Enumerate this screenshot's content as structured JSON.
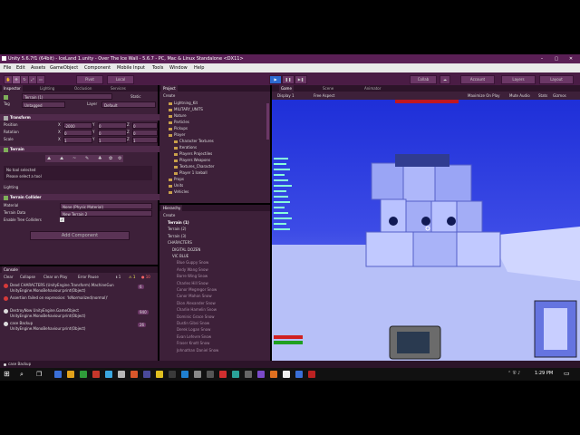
{
  "window": {
    "title": "Unity 5.6.7f1 (64bit) - IceLand 1.unity - Over The Ice Wall - 5.6.7 - PC, Mac & Linux Standalone <DX11>",
    "minimize": "–",
    "maximize": "▢",
    "close": "✕"
  },
  "menu": [
    "File",
    "Edit",
    "Assets",
    "GameObject",
    "Component",
    "Mobile Input",
    "Tools",
    "Window",
    "Help"
  ],
  "toolbar": {
    "pivot": "Pivot",
    "local": "Local",
    "play": "▶",
    "pause": "❚❚",
    "step": "▶❚",
    "collab": "Collab",
    "account": "Account",
    "layers": "Layers",
    "layout": "Layout"
  },
  "inspector": {
    "tabs": [
      "Inspector",
      "Lighting",
      "Occlusion",
      "Services"
    ],
    "object_name": "Terrain (1)",
    "static_label": "Static",
    "tag_label": "Tag",
    "tag_value": "Untagged",
    "layer_label": "Layer",
    "layer_value": "Default",
    "transform_header": "Transform",
    "position_label": "Position",
    "pos_x": "-2000",
    "pos_y": "0",
    "pos_z": "0",
    "rotation_label": "Rotation",
    "rot_x": "0",
    "rot_y": "0",
    "rot_z": "0",
    "scale_label": "Scale",
    "scale_x": "1",
    "scale_y": "1",
    "scale_z": "1",
    "terrain_header": "Terrain",
    "no_tool": "No tool selected",
    "select_tool": "Please select a tool",
    "lighting_label": "Lighting",
    "collider_header": "Terrain Collider",
    "material_label": "Material",
    "material_value": "None (Physic Material)",
    "terrain_data_label": "Terrain Data",
    "terrain_data_value": "New Terrain 2",
    "enable_trees_label": "Enable Tree Colliders",
    "add_component": "Add Component"
  },
  "project": {
    "tab": "Project",
    "create": "Create",
    "items": [
      "Lightning_Kit",
      "MILITARY_UNITS",
      "Nature",
      "Particles",
      "Pickups",
      "Player",
      "Character Textures",
      "Iterations",
      "Players Projectiles",
      "Players Weapons",
      "Textures_Character",
      "Player 1 Iceball",
      "Props",
      "Units",
      "Vehicles"
    ]
  },
  "hierarchy": {
    "tab": "Hierarchy",
    "create": "Create",
    "items": [
      "Terrain (1)",
      "Terrain (2)",
      "Terrain (3)",
      "CHARACTERS",
      "DIGITAL DOZEN",
      "VIC BLUE",
      "Blue Guppy Snow",
      "Andy Wang Snow",
      "Barre Wing Snow",
      "Charles Hill Snow",
      "Conor Megregor Snow",
      "Conor Mahon Snow",
      "Dion Alexander Snow",
      "Charlie Hamelin Snow",
      "Dominic Grace Snow",
      "Dustin Gibsi Snow",
      "Derek Logan Snow",
      "Evan Lefevre Snow",
      "Fraser Knott Snow",
      "Johnathan Daniel Snow"
    ]
  },
  "game": {
    "tabs": [
      "Game",
      "Scene",
      "Animator"
    ],
    "display": "Display 1",
    "aspect": "Free Aspect",
    "maximize_on_play": "Maximize On Play",
    "mute_audio": "Mute Audio",
    "stats": "Stats",
    "gizmos": "Gizmos"
  },
  "console": {
    "tab": "Console",
    "buttons": [
      "Clear",
      "Collapse",
      "Clear on Play",
      "Error Pause"
    ],
    "count_warn": "1",
    "count_err": "10",
    "count_log": "1",
    "messages": [
      {
        "line1": "Dead CHARACTERS (UnityEngine.Transform).MachineGun",
        "line2": "UnityEngine.MonoBehaviour:print(Object)",
        "count": "6"
      },
      {
        "line1": "Assertion failed on expression: 'IsNormalized(normal)'",
        "line2": "",
        "count": ""
      },
      {
        "line1": "DestroyNow UnityEngine.GameObject",
        "line2": "UnityEngine.MonoBehaviour:print(Object)",
        "count": "940"
      },
      {
        "line1": "case Backup",
        "line2": "UnityEngine.MonoBehaviour:print(Object)",
        "count": "26"
      }
    ],
    "status": "case Backup"
  },
  "taskbar": {
    "time": "1:29 PM",
    "icons": [
      "windows-icon",
      "search-icon",
      "taskview-icon"
    ]
  },
  "colors": {
    "title": "#5a1f55",
    "panel": "#3d2039",
    "sky": "#2a39d6",
    "snow": "#aab5ff"
  }
}
